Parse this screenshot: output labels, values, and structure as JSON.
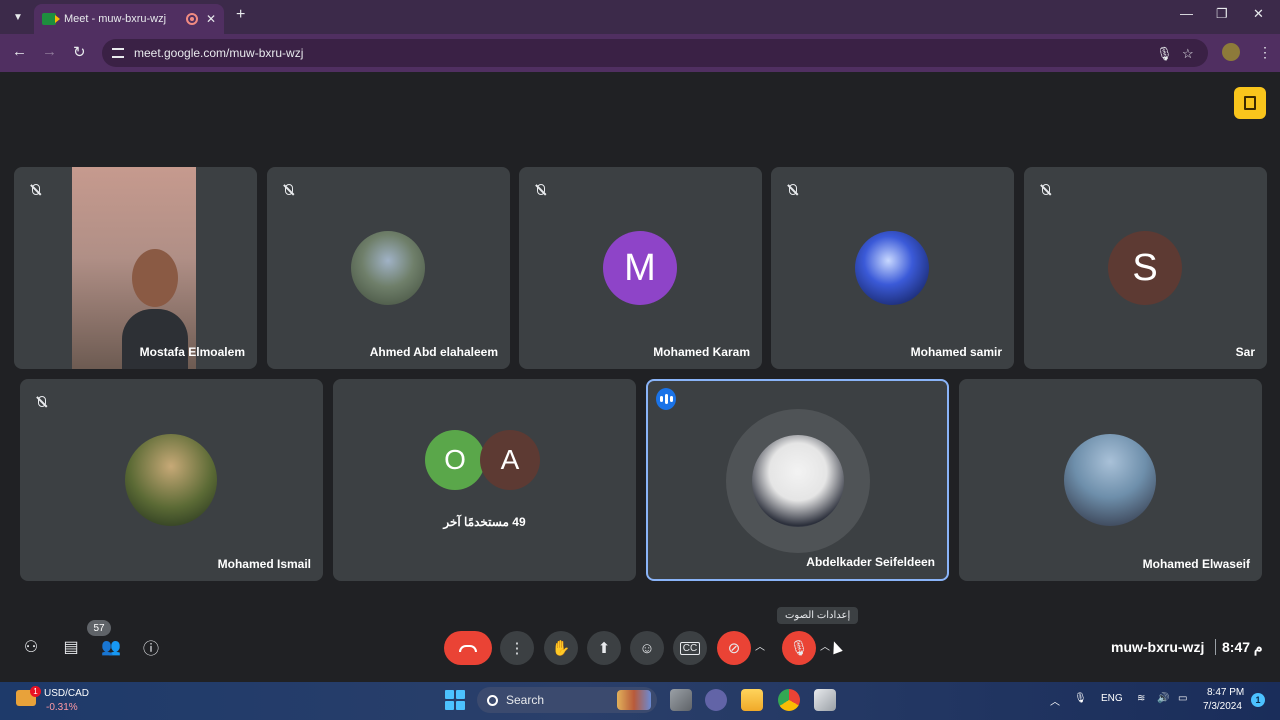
{
  "browser": {
    "tab_title": "Meet - muw-bxru-wzj",
    "url": "meet.google.com/muw-bxru-wzj",
    "new_tab_symbol": "+",
    "close_tab_symbol": "✕",
    "window_controls": {
      "minimize": "—",
      "restore": "❐",
      "close": "✕"
    }
  },
  "participants": [
    {
      "name": "Mostafa Elmoalem",
      "type": "video",
      "muted": true
    },
    {
      "name": "Ahmed Abd elahaleem",
      "type": "photo",
      "muted": true
    },
    {
      "name": "Mohamed Karam",
      "type": "initial",
      "initial": "M",
      "color": "#8e44c8",
      "muted": true
    },
    {
      "name": "Mohamed samir",
      "type": "photo",
      "muted": true
    },
    {
      "name": "Sar",
      "type": "initial",
      "initial": "S",
      "color": "#5d3a33",
      "muted": true
    },
    {
      "name": "Mohamed Ismail",
      "type": "photo",
      "muted": true
    },
    {
      "name": "Abdelkader Seifeldeen",
      "type": "photo",
      "speaking": true
    },
    {
      "name": "Mohamed Elwaseif",
      "type": "photo"
    }
  ],
  "others_tile": {
    "initials": [
      "O",
      "A"
    ],
    "colors": [
      "#5aa74a",
      "#5d3a33"
    ],
    "label": "49 مستخدمًا آخر"
  },
  "controls": {
    "participants_count": "57",
    "tooltip": "إعدادات الصوت",
    "meeting_code": "muw-bxru-wzj",
    "meeting_time": "8:47 م"
  },
  "taskbar": {
    "ticker_name": "USD/CAD",
    "ticker_change": "-0.31%",
    "ticker_badge": "1",
    "search_placeholder": "Search",
    "language": "ENG",
    "time": "8:47 PM",
    "date": "7/3/2024",
    "notification_count": "1"
  }
}
